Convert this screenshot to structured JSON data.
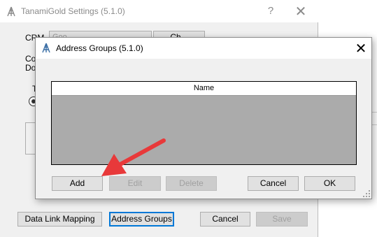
{
  "back_window": {
    "title": "TanamiGold Settings (5.1.0)",
    "help_glyph": "?",
    "close_glyph": "✕",
    "crm_label": "CRM",
    "crm_value": "Goo...",
    "change_label": "Ch...",
    "cut_label_1": "Co",
    "cut_label_2": "Do",
    "cut_label_3": "T",
    "buttons": {
      "data_link_mapping": "Data Link Mapping",
      "address_groups": "Address Groups",
      "cancel": "Cancel",
      "save": "Save"
    }
  },
  "dialog": {
    "title": "Address Groups (5.1.0)",
    "close_glyph": "✕",
    "grid": {
      "columns": [
        "Name"
      ],
      "rows": []
    },
    "buttons": {
      "add": "Add",
      "edit": "Edit",
      "delete": "Delete",
      "cancel": "Cancel",
      "ok": "OK"
    }
  },
  "annotation": {
    "arrow_color": "#e8393a",
    "points_to": "Add"
  },
  "colors": {
    "window_bg": "#f0f0f0",
    "grid_bg": "#ababab",
    "focus_border": "#0078d7"
  }
}
